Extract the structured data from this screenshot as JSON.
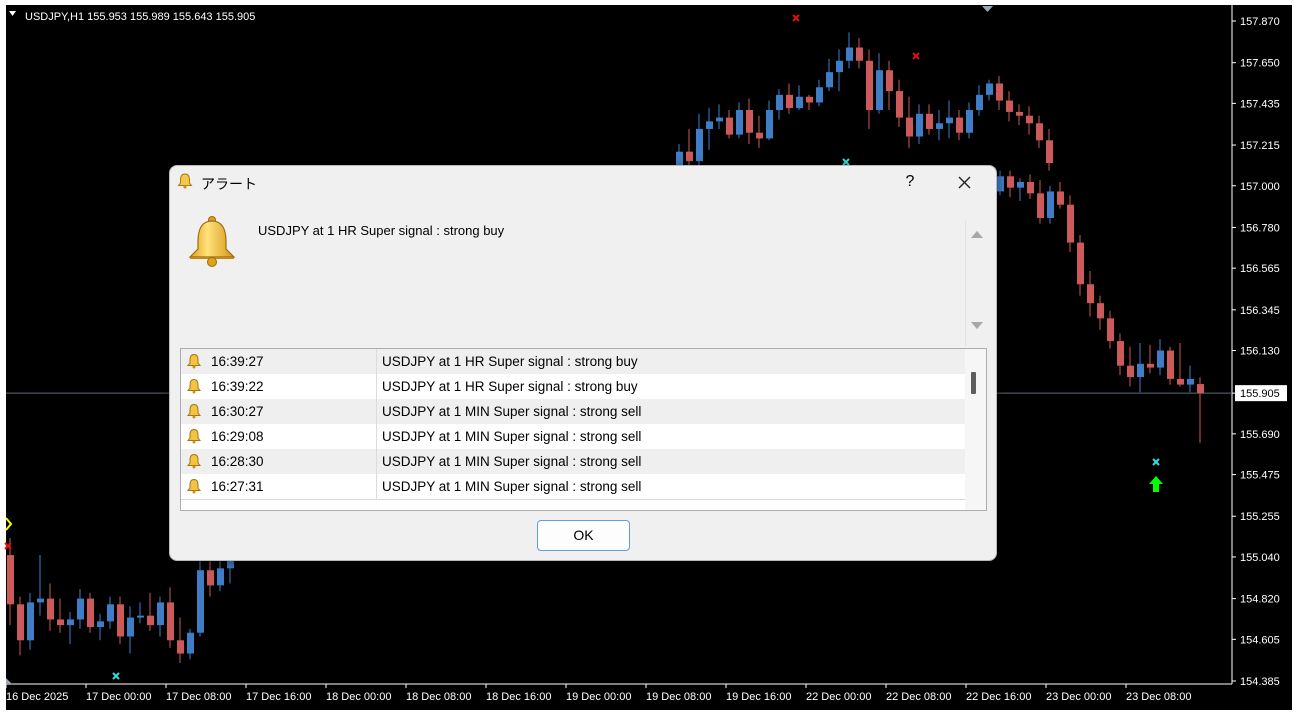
{
  "chart": {
    "header": "USDJPY,H1  155.953 155.989 155.643 155.905",
    "current_price": "155.905",
    "price_labels": [
      "157.870",
      "157.650",
      "157.435",
      "157.215",
      "157.000",
      "156.780",
      "156.565",
      "156.345",
      "156.130",
      "155.905",
      "155.690",
      "155.475",
      "155.255",
      "155.040",
      "154.820",
      "154.605",
      "154.385"
    ],
    "time_labels": [
      "16 Dec 2025",
      "17 Dec 00:00",
      "17 Dec 08:00",
      "17 Dec 16:00",
      "18 Dec 00:00",
      "18 Dec 08:00",
      "18 Dec 16:00",
      "19 Dec 00:00",
      "19 Dec 08:00",
      "19 Dec 16:00",
      "22 Dec 00:00",
      "22 Dec 08:00",
      "22 Dec 16:00",
      "23 Dec 00:00",
      "23 Dec 08:00"
    ],
    "colors": {
      "background": "#000000",
      "bull": "#3f7ec7",
      "bear": "#cc5a5a",
      "sell_mark": "#e01010",
      "cyan_mark": "#30e0e0",
      "buy_arrow": "#00ff00",
      "yellow_mark": "#ffff00",
      "text": "#ffffff"
    }
  },
  "chart_data": {
    "type": "candlestick",
    "symbol": "USDJPY",
    "timeframe": "H1",
    "ylim": [
      154.385,
      157.87
    ],
    "visible_segments": [
      {
        "range": "16 Dec 2025 – 17 Dec 10:00",
        "candles": [
          [
            155.05,
            155.14,
            154.68,
            154.79
          ],
          [
            154.79,
            154.83,
            154.52,
            154.6
          ],
          [
            154.6,
            154.85,
            154.55,
            154.8
          ],
          [
            154.8,
            155.05,
            154.73,
            154.82
          ],
          [
            154.82,
            154.9,
            154.65,
            154.71
          ],
          [
            154.71,
            154.82,
            154.64,
            154.68
          ],
          [
            154.68,
            154.75,
            154.58,
            154.71
          ],
          [
            154.71,
            154.87,
            154.66,
            154.82
          ],
          [
            154.82,
            154.85,
            154.64,
            154.67
          ],
          [
            154.67,
            154.74,
            154.6,
            154.7
          ],
          [
            154.7,
            154.83,
            154.66,
            154.79
          ],
          [
            154.79,
            154.83,
            154.58,
            154.62
          ],
          [
            154.62,
            154.78,
            154.53,
            154.72
          ],
          [
            154.72,
            154.8,
            154.69,
            154.73
          ],
          [
            154.73,
            154.85,
            154.65,
            154.68
          ],
          [
            154.68,
            154.83,
            154.62,
            154.8
          ],
          [
            154.8,
            154.88,
            154.56,
            154.6
          ],
          [
            154.6,
            154.72,
            154.48,
            154.53
          ],
          [
            154.53,
            154.66,
            154.5,
            154.64
          ],
          [
            154.64,
            155.03,
            154.62,
            154.97
          ],
          [
            154.97,
            155.03,
            154.83,
            154.89
          ],
          [
            154.89,
            155.04,
            154.86,
            154.98
          ],
          [
            154.98,
            155.22,
            154.9,
            155.2
          ],
          [
            155.2,
            155.24,
            155.16,
            155.2
          ],
          [
            155.2,
            155.45,
            155.17,
            155.4
          ],
          [
            155.4,
            155.55,
            155.37,
            155.5
          ]
        ]
      },
      {
        "range": "19 Dec 08:00 – 22 Dec 04:00",
        "candles": [
          [
            157.1,
            157.22,
            157.08,
            157.18
          ],
          [
            157.18,
            157.3,
            156.98,
            157.13
          ],
          [
            157.13,
            157.38,
            157.1,
            157.3
          ],
          [
            157.3,
            157.41,
            157.19,
            157.34
          ],
          [
            157.34,
            157.43,
            157.3,
            157.36
          ],
          [
            157.36,
            157.4,
            157.25,
            157.27
          ],
          [
            157.27,
            157.44,
            157.25,
            157.4
          ],
          [
            157.4,
            157.46,
            157.22,
            157.28
          ],
          [
            157.28,
            157.37,
            157.2,
            157.25
          ],
          [
            157.25,
            157.45,
            157.24,
            157.4
          ],
          [
            157.4,
            157.51,
            157.35,
            157.48
          ],
          [
            157.48,
            157.54,
            157.38,
            157.41
          ],
          [
            157.41,
            157.53,
            157.4,
            157.47
          ],
          [
            157.47,
            157.48,
            157.4,
            157.44
          ],
          [
            157.44,
            157.56,
            157.42,
            157.52
          ],
          [
            157.52,
            157.67,
            157.5,
            157.6
          ],
          [
            157.6,
            157.72,
            157.5,
            157.66
          ],
          [
            157.66,
            157.81,
            157.62,
            157.73
          ],
          [
            157.73,
            157.78,
            157.62,
            157.66
          ],
          [
            157.66,
            157.72,
            157.3,
            157.4
          ],
          [
            157.4,
            157.7,
            157.38,
            157.61
          ],
          [
            157.61,
            157.66,
            157.4,
            157.5
          ],
          [
            157.5,
            157.56,
            157.31,
            157.36
          ],
          [
            157.36,
            157.47,
            157.2,
            157.26
          ],
          [
            157.26,
            157.43,
            157.22,
            157.38
          ],
          [
            157.38,
            157.43,
            157.27,
            157.3
          ],
          [
            157.3,
            157.4,
            157.24,
            157.33
          ],
          [
            157.33,
            157.45,
            157.25,
            157.36
          ],
          [
            157.36,
            157.4,
            157.24,
            157.28
          ],
          [
            157.28,
            157.44,
            157.25,
            157.4
          ],
          [
            157.4,
            157.53,
            157.37,
            157.48
          ],
          [
            157.48,
            157.56,
            157.45,
            157.54
          ],
          [
            157.54,
            157.58,
            157.4,
            157.45
          ],
          [
            157.45,
            157.5,
            157.34,
            157.39
          ],
          [
            157.39,
            157.43,
            157.32,
            157.37
          ],
          [
            157.37,
            157.42,
            157.27,
            157.33
          ],
          [
            157.33,
            157.37,
            157.2,
            157.24
          ],
          [
            157.24,
            157.3,
            157.08,
            157.12
          ]
        ]
      },
      {
        "range": "22 Dec 16:00 – 23 Dec 09:00",
        "candles": [
          [
            157.0,
            157.1,
            156.92,
            156.92
          ],
          [
            156.92,
            157.04,
            156.88,
            157.0
          ],
          [
            157.0,
            157.03,
            156.9,
            156.97
          ],
          [
            156.97,
            157.08,
            156.95,
            157.05
          ],
          [
            157.05,
            157.08,
            156.94,
            156.99
          ],
          [
            156.99,
            157.04,
            156.92,
            157.02
          ],
          [
            157.02,
            157.06,
            156.93,
            156.96
          ],
          [
            156.96,
            157.03,
            156.8,
            156.83
          ],
          [
            156.83,
            157.0,
            156.8,
            156.97
          ],
          [
            156.97,
            157.02,
            156.88,
            156.9
          ],
          [
            156.9,
            156.95,
            156.65,
            156.7
          ],
          [
            156.7,
            156.74,
            156.42,
            156.48
          ],
          [
            156.48,
            156.55,
            156.31,
            156.38
          ],
          [
            156.38,
            156.42,
            156.24,
            156.3
          ],
          [
            156.3,
            156.34,
            156.14,
            156.18
          ],
          [
            156.18,
            156.22,
            156.0,
            156.05
          ],
          [
            156.05,
            156.15,
            155.94,
            155.99
          ],
          [
            155.99,
            156.17,
            155.91,
            156.06
          ],
          [
            156.06,
            156.16,
            156.01,
            156.04
          ],
          [
            156.04,
            156.19,
            156.0,
            156.13
          ],
          [
            156.13,
            156.15,
            155.95,
            155.98
          ],
          [
            155.98,
            156.17,
            155.94,
            155.95
          ],
          [
            155.95,
            156.05,
            155.91,
            155.98
          ],
          [
            155.953,
            155.989,
            155.643,
            155.905
          ]
        ]
      }
    ]
  },
  "dialog": {
    "title": "アラート",
    "help_label": "?",
    "message": "USDJPY at 1 HR Super signal : strong buy",
    "ok_label": "OK",
    "rows": [
      {
        "time": "16:39:27",
        "message": "USDJPY at 1 HR Super signal : strong buy"
      },
      {
        "time": "16:39:22",
        "message": "USDJPY at 1 HR Super signal : strong buy"
      },
      {
        "time": "16:30:27",
        "message": "USDJPY at 1 MIN Super signal : strong sell"
      },
      {
        "time": "16:29:08",
        "message": "USDJPY at 1 MIN Super signal : strong sell"
      },
      {
        "time": "16:28:30",
        "message": "USDJPY at 1 MIN Super signal : strong sell"
      },
      {
        "time": "16:27:31",
        "message": "USDJPY at 1 MIN Super signal : strong sell"
      }
    ]
  }
}
